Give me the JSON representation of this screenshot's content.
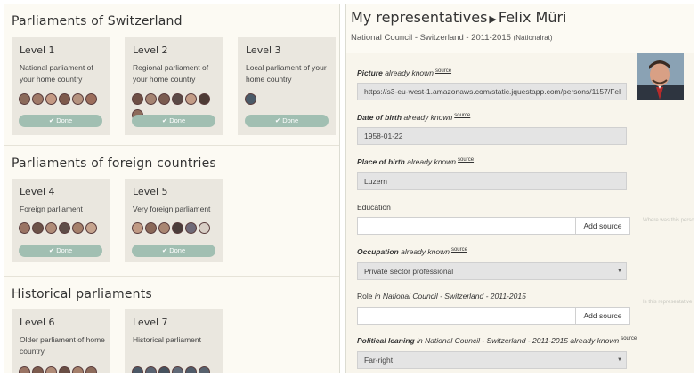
{
  "left": {
    "sections": [
      {
        "title": "Parliaments of Switzerland",
        "cards": [
          {
            "level": "Level 1",
            "desc": "National parliament of your home country",
            "done": "✔ Done"
          },
          {
            "level": "Level 2",
            "desc": "Regional parliament of your home country",
            "done": "✔ Done"
          },
          {
            "level": "Level 3",
            "desc": "Local parliament of your home country",
            "done": "✔ Done"
          }
        ]
      },
      {
        "title": "Parliaments of foreign countries",
        "cards": [
          {
            "level": "Level 4",
            "desc": "Foreign parliament",
            "done": "✔ Done"
          },
          {
            "level": "Level 5",
            "desc": "Very foreign parliament",
            "done": "✔ Done"
          }
        ]
      },
      {
        "title": "Historical parliaments",
        "cards": [
          {
            "level": "Level 6",
            "desc": "Older parliament of home country"
          },
          {
            "level": "Level 7",
            "desc": "Historical parliament"
          }
        ]
      }
    ]
  },
  "right": {
    "title": "My representatives",
    "name": "Felix Müri",
    "subtitle": "National Council - Switzerland - 2011-2015",
    "subtitle_note": "(Nationalrat)",
    "picture": {
      "label": "Picture",
      "known": "already known",
      "source": "source",
      "value": "https://s3-eu-west-1.amazonaws.com/static.jquestapp.com/persons/1157/Fel"
    },
    "dob": {
      "label": "Date of birth",
      "known": "already known",
      "source": "source",
      "value": "1958-01-22"
    },
    "pob": {
      "label": "Place of birth",
      "known": "already known",
      "source": "source",
      "value": "Luzern"
    },
    "education": {
      "label": "Education",
      "add": "Add source",
      "hint": "Where was this person educated? University or school"
    },
    "occupation": {
      "label": "Occupation",
      "known": "already known",
      "source": "source",
      "value": "Private sector professional"
    },
    "role": {
      "label_a": "Role",
      "label_b": "in National Council - Switzerland - 2011-2015",
      "add": "Add source",
      "hint": "Is this representative also hold a special role in the assembly?"
    },
    "leaning": {
      "label_a": "Political leaning",
      "label_b": "in National Council - Switzerland - 2011-2015",
      "known": "already known",
      "source": "source",
      "value": "Far-right"
    }
  }
}
